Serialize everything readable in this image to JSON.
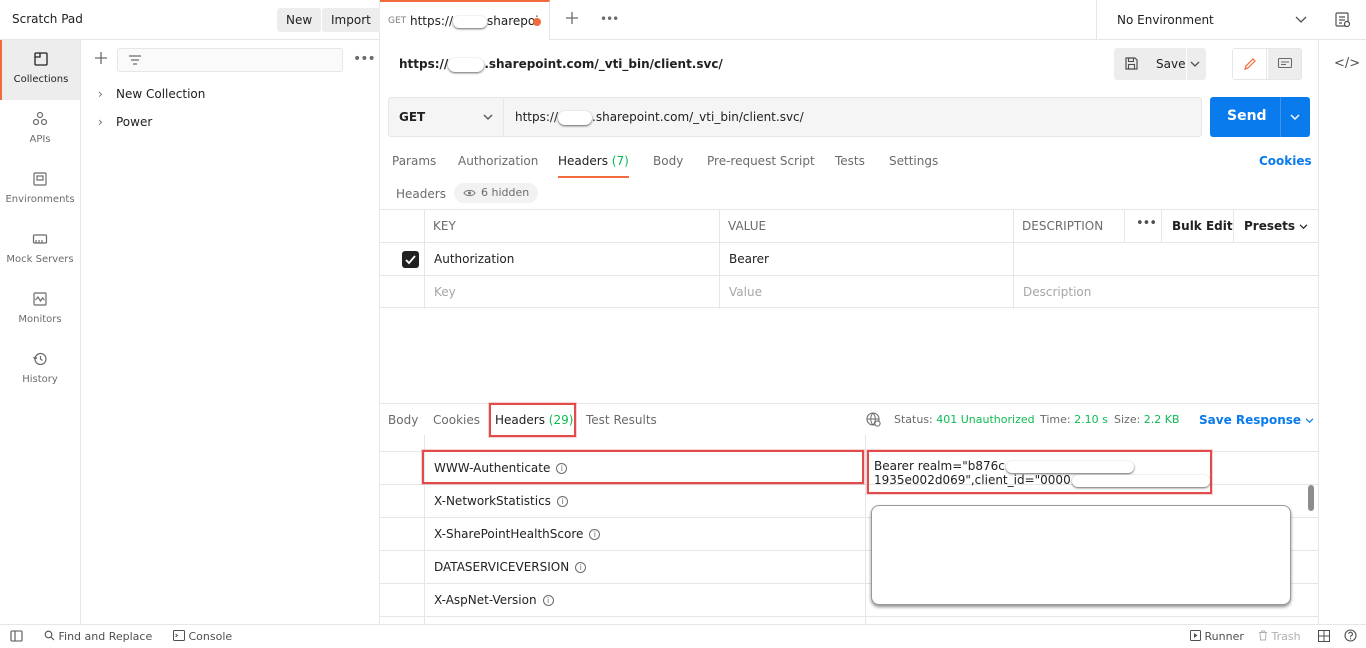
{
  "left_panel": {
    "title": "Scratch Pad",
    "new_label": "New",
    "import_label": "Import",
    "nav": [
      {
        "label": "Collections",
        "icon": "collections-icon"
      },
      {
        "label": "APIs",
        "icon": "apis-icon"
      },
      {
        "label": "Environments",
        "icon": "environments-icon"
      },
      {
        "label": "Mock Servers",
        "icon": "mock-servers-icon"
      },
      {
        "label": "Monitors",
        "icon": "monitors-icon"
      },
      {
        "label": "History",
        "icon": "history-icon"
      }
    ],
    "collections": [
      "New Collection",
      "Power"
    ]
  },
  "tabbar": {
    "tab_method": "GET",
    "tab_url_prefix": "https://",
    "tab_url_suffix": "sharepoi",
    "environment": "No Environment"
  },
  "request": {
    "name_prefix": "https://",
    "name_suffix": ".sharepoint.com/_vti_bin/client.svc/",
    "save_label": "Save",
    "method": "GET",
    "url_prefix": "https://",
    "url_suffix": ".sharepoint.com/_vti_bin/client.svc/",
    "send_label": "Send",
    "tabs": {
      "params": "Params",
      "authorization": "Authorization",
      "headers": "Headers",
      "headers_count": "(7)",
      "body": "Body",
      "prerequest": "Pre-request Script",
      "tests": "Tests",
      "settings": "Settings"
    },
    "cookies_label": "Cookies",
    "headers_sub": "Headers",
    "hidden_label": "6 hidden",
    "table": {
      "col_key": "KEY",
      "col_value": "VALUE",
      "col_description": "DESCRIPTION",
      "bulk_edit": "Bulk Edit",
      "presets": "Presets",
      "rows": [
        {
          "key": "Authorization",
          "value": "Bearer",
          "description": ""
        }
      ],
      "placeholder_key": "Key",
      "placeholder_value": "Value",
      "placeholder_description": "Description"
    }
  },
  "response": {
    "tabs": {
      "body": "Body",
      "cookies": "Cookies",
      "headers": "Headers",
      "headers_count": "(29)",
      "test_results": "Test Results"
    },
    "status_label": "Status:",
    "status_value": "401 Unauthorized",
    "time_label": "Time:",
    "time_value": "2.10 s",
    "size_label": "Size:",
    "size_value": "2.2 KB",
    "save_response": "Save Response",
    "header_rows": [
      {
        "key": "WWW-Authenticate"
      },
      {
        "key": "X-NetworkStatistics"
      },
      {
        "key": "X-SharePointHealthScore"
      },
      {
        "key": "DATASERVICEVERSION"
      },
      {
        "key": "X-AspNet-Version"
      }
    ],
    "auth_value_line1_prefix": "Bearer realm=\"b876c",
    "auth_value_line2_prefix": "1935e002d069\",client_id=\"0000"
  },
  "footer": {
    "find_replace": "Find and Replace",
    "console": "Console",
    "runner": "Runner",
    "trash": "Trash"
  },
  "colors": {
    "accent": "#f26b3a",
    "primary": "#097bed",
    "success": "#0cbb52",
    "highlight": "#e14b4b"
  }
}
